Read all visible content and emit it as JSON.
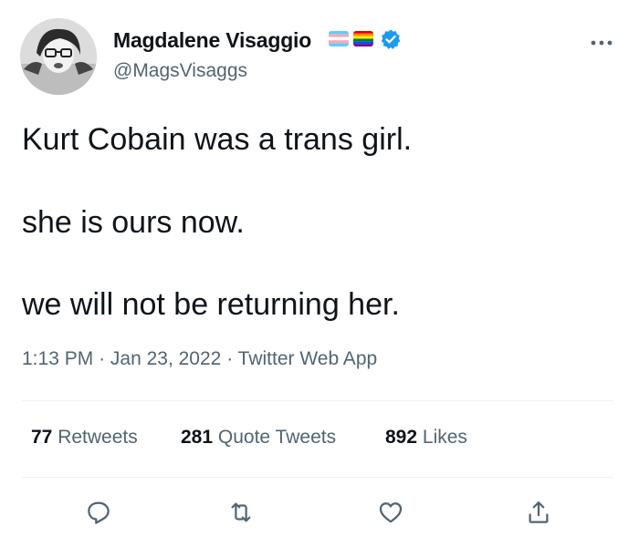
{
  "author": {
    "display_name": "Magdalene Visaggio",
    "handle": "@MagsVisaggs",
    "flags": [
      "transgender-flag-icon",
      "rainbow-flag-icon"
    ],
    "verified": true
  },
  "tweet": {
    "lines": [
      "Kurt Cobain was a trans girl.",
      "she is ours now.",
      "we will not be returning her."
    ],
    "time": "1:13 PM",
    "date": "Jan 23, 2022",
    "source": "Twitter Web App",
    "separator": "·"
  },
  "stats": {
    "retweets_count": "77",
    "retweets_label": "Retweets",
    "quotes_count": "281",
    "quotes_label": "Quote Tweets",
    "likes_count": "892",
    "likes_label": "Likes"
  },
  "actions": [
    "reply-icon",
    "retweet-icon",
    "like-icon",
    "share-icon"
  ],
  "colors": {
    "text": "#0f1419",
    "secondary": "#536471",
    "verified": "#1d9bf0",
    "divider": "#eff3f4"
  }
}
